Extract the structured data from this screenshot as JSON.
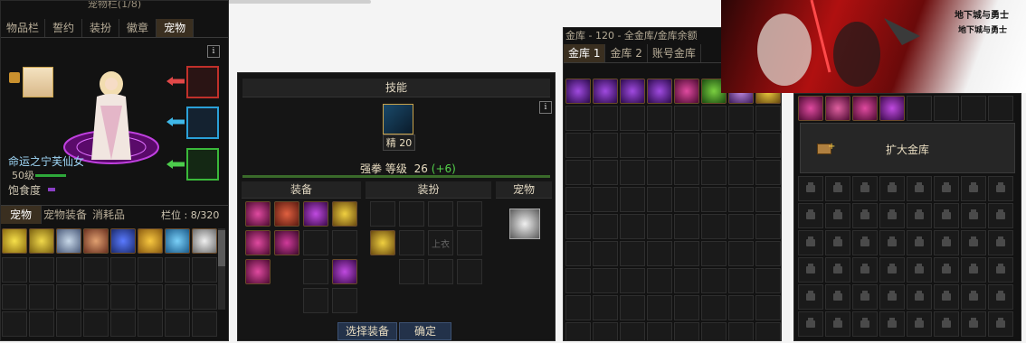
{
  "panel1": {
    "title": "宠物栏(1/8)",
    "top_tabs": [
      "物品栏",
      "誓约",
      "装扮",
      "徽章",
      "宠物"
    ],
    "info_icon": "i",
    "pet_name": "命运之宁芙仙女",
    "pet_level": "50级",
    "satiety_label": "饱食度",
    "bottom_tabs": [
      "宠物",
      "宠物装备",
      "消耗品"
    ],
    "slot_label": "栏位 : 8/320"
  },
  "panel2": {
    "header": "技能",
    "info_icon": "i",
    "skill_badge": "精 20",
    "skill_line_label": "强拳 等级",
    "skill_level": "26",
    "skill_bonus": "(+6)",
    "sec_equip": "装备",
    "sec_avatar": "装扮",
    "sec_pet": "宠物",
    "avatar_slot_text": "上衣",
    "btn_select": "选择装备",
    "btn_confirm": "确定"
  },
  "panel3": {
    "title_partial": "金库 - 120 - 全金库/金库余额",
    "tabs": [
      "金库 1",
      "金库 2",
      "账号金库"
    ]
  },
  "panel4": {
    "banner_logo_1": "地下城与勇士",
    "banner_logo_2": "地下城与勇士",
    "expand_label": "扩大金库"
  },
  "colors": {
    "panel_bg": "#121212",
    "tab_active": "#3a2f20",
    "button_blue": "#23324a",
    "green_text": "#54d24a",
    "satiety_purple": "#8a3fc4",
    "level_green": "#2ea83a"
  }
}
